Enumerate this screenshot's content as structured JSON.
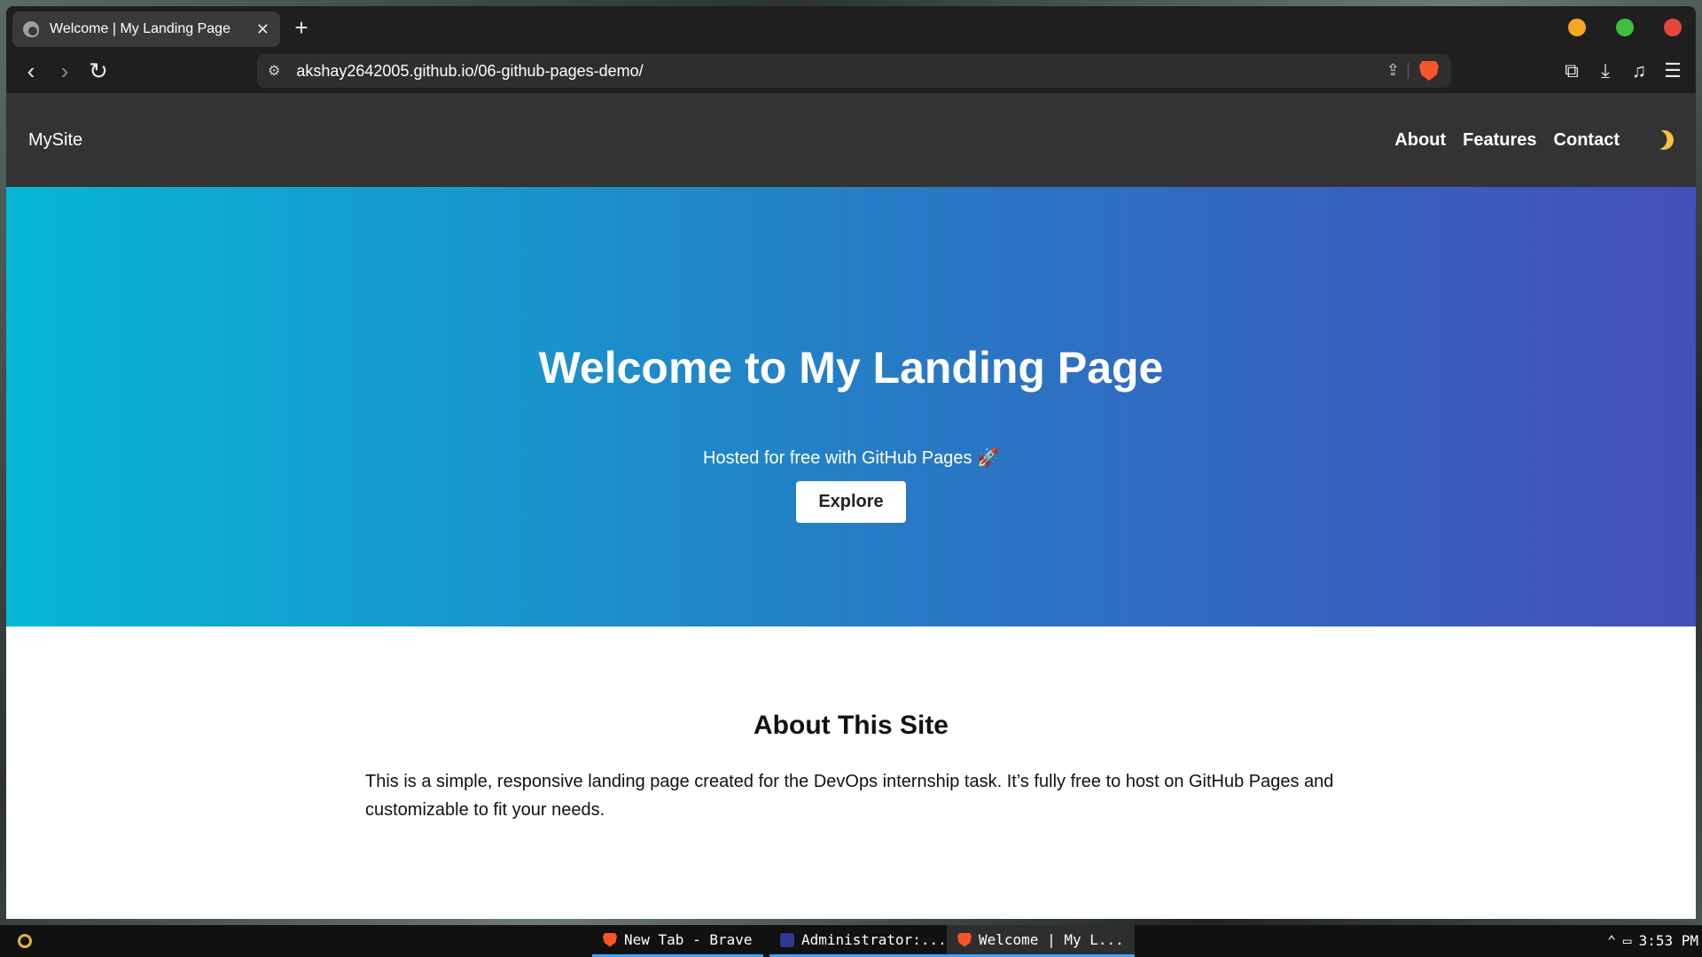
{
  "browser": {
    "tab_title": "Welcome | My Landing Page",
    "tab_close": "✕",
    "new_tab": "+",
    "url": "akshay2642005.github.io/06-github-pages-demo/"
  },
  "site": {
    "brand": "MySite",
    "nav": [
      "About",
      "Features",
      "Contact"
    ],
    "hero": {
      "title": "Welcome to My Landing Page",
      "subtitle": "Hosted for free with GitHub Pages 🚀",
      "button": "Explore"
    },
    "about": {
      "heading": "About This Site",
      "text": "This is a simple, responsive landing page created for the DevOps internship task. It’s fully free to host on GitHub Pages and customizable to fit your needs."
    }
  },
  "taskbar": {
    "tasks": [
      "New Tab - Brave",
      "Administrator:...",
      "Welcome | My L..."
    ],
    "time": "3:53 PM"
  }
}
